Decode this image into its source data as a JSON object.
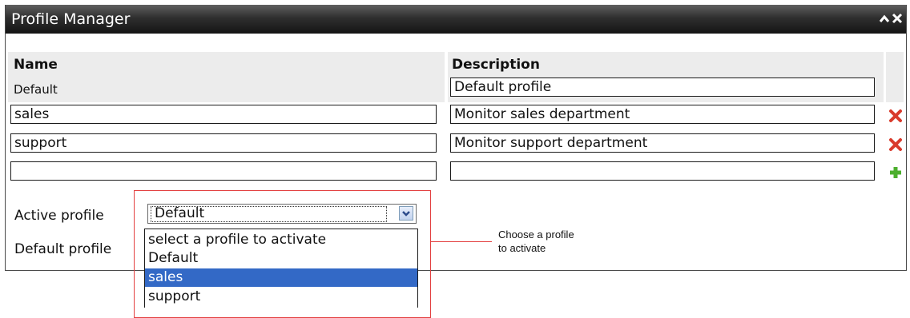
{
  "window": {
    "title": "Profile Manager"
  },
  "table": {
    "headers": {
      "name": "Name",
      "description": "Description"
    },
    "default_row": {
      "name": "Default",
      "description": "Default profile"
    },
    "rows": [
      {
        "name": "sales",
        "description": "Monitor sales department"
      },
      {
        "name": "support",
        "description": "Monitor support department"
      }
    ],
    "new_row": {
      "name": "",
      "description": ""
    }
  },
  "icons": {
    "collapse": "chevron-up-icon",
    "close": "close-icon",
    "delete": "delete-x-icon",
    "add": "add-plus-icon",
    "dropdown": "chevron-down-icon"
  },
  "form": {
    "active_profile_label": "Active profile",
    "default_profile_label": "Default profile",
    "active_profile_value": "Default",
    "options": [
      "select a profile to activate",
      "Default",
      "sales",
      "support"
    ],
    "highlighted_option": "sales"
  },
  "callout": {
    "line1": "Choose a profile",
    "line2": "to activate"
  },
  "colors": {
    "titlebar": "#1f1f1f",
    "header_bg": "#ececec",
    "selected_option": "#3369c6",
    "delete_icon": "#d93a2b",
    "add_icon": "#4caf2e",
    "callout": "#e34040"
  }
}
